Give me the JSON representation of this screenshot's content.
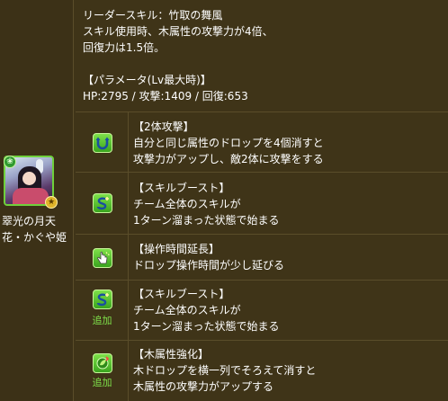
{
  "leader_skill": {
    "lines": [
      "リーダースキル：竹取の舞風",
      "スキル使用時、木属性の攻撃力が4倍、",
      "回復力は1.5倍。"
    ]
  },
  "parameters": {
    "header": "【パラメータ(Lv最大時)】",
    "stats": "HP:2795 / 攻撃:1409 / 回復:653"
  },
  "character": {
    "name_line1": "翠光の月天",
    "name_line2": "花・かぐや姫",
    "attribute": "wood",
    "attr_glyph": "❀",
    "star_glyph": "★"
  },
  "awakenings": [
    {
      "icon": "two-pronged-attack-icon",
      "title": "【2体攻撃】",
      "lines": [
        "自分と同じ属性のドロップを4個消すと",
        "攻撃力がアップし、敵2体に攻撃をする"
      ],
      "added": ""
    },
    {
      "icon": "skill-boost-icon",
      "title": "【スキルブースト】",
      "lines": [
        "チーム全体のスキルが",
        "1ターン溜まった状態で始まる"
      ],
      "added": ""
    },
    {
      "icon": "time-extend-icon",
      "title": "【操作時間延長】",
      "lines": [
        "ドロップ操作時間が少し延びる"
      ],
      "added": ""
    },
    {
      "icon": "skill-boost-icon",
      "title": "【スキルブースト】",
      "lines": [
        "チーム全体のスキルが",
        "1ターン溜まった状態で始まる"
      ],
      "added": "追加"
    },
    {
      "icon": "wood-row-enhance-icon",
      "title": "【木属性強化】",
      "lines": [
        "木ドロップを横一列でそろえて消すと",
        "木属性の攻撃力がアップする"
      ],
      "added": "追加"
    }
  ],
  "colors": {
    "background": "#3f3418",
    "divider": "#5a4d2a",
    "icon_green": "#3aa41e",
    "added_text": "#7fe04a"
  }
}
